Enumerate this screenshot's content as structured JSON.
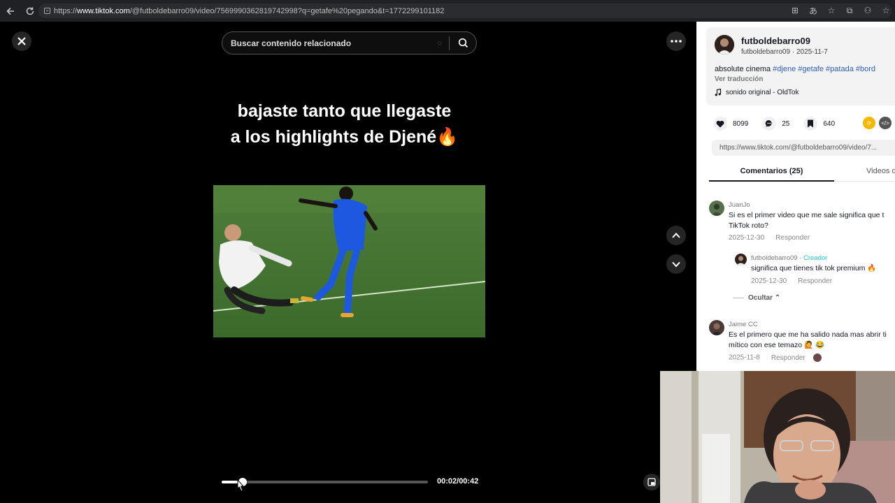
{
  "browser": {
    "url_prefix": "https://",
    "url_host": "www.tiktok.com",
    "url_path": "/@futboldebarro09/video/7569990362819742998?q=getafe%20pegando&t=1772299101182"
  },
  "search": {
    "placeholder": "Buscar contenido relacionado"
  },
  "video": {
    "caption_line1": "bajaste tanto que llegaste",
    "caption_line2": "a los highlights de Djené",
    "caption_emoji": "🔥",
    "time": "00:02/00:42",
    "progress_fraction": 0.0476
  },
  "post": {
    "author": "futboldebarro09",
    "author_meta": "futboldebarro09 · 2025-11-7",
    "description_text": "absolute cinema",
    "hashtags": [
      "#djene",
      "#getafe",
      "#patada",
      "#bord"
    ],
    "translate": "Ver traducción",
    "sound": "sonido original - OldTok",
    "likes": "8099",
    "comments": "25",
    "saves": "640",
    "link": "https://www.tiktok.com/@futboldebarro09/video/7..."
  },
  "tabs": {
    "comments": "Comentarios (25)",
    "videos": "Videos d"
  },
  "comments": [
    {
      "user": "JuanJo",
      "text_line1": "Si es el primer video que me sale significa que t",
      "text_line2": "TikTok roto?",
      "date": "2025-12-30",
      "reply": "Responder"
    },
    {
      "user": "futboldebarro09",
      "badge": "Creador",
      "text_line1": "significa que tienes tik tok premium 🔥",
      "date": "2025-12-30",
      "reply": "Responder"
    },
    {
      "user": "Jaime CC",
      "text_line1": "Es el primero que me ha salido nada mas abrir ti",
      "text_line2": "mítico con ese temazo 🙋 😂",
      "date": "2025-11-8",
      "reply": "Responder"
    }
  ],
  "hide_replies": "Ocultar"
}
